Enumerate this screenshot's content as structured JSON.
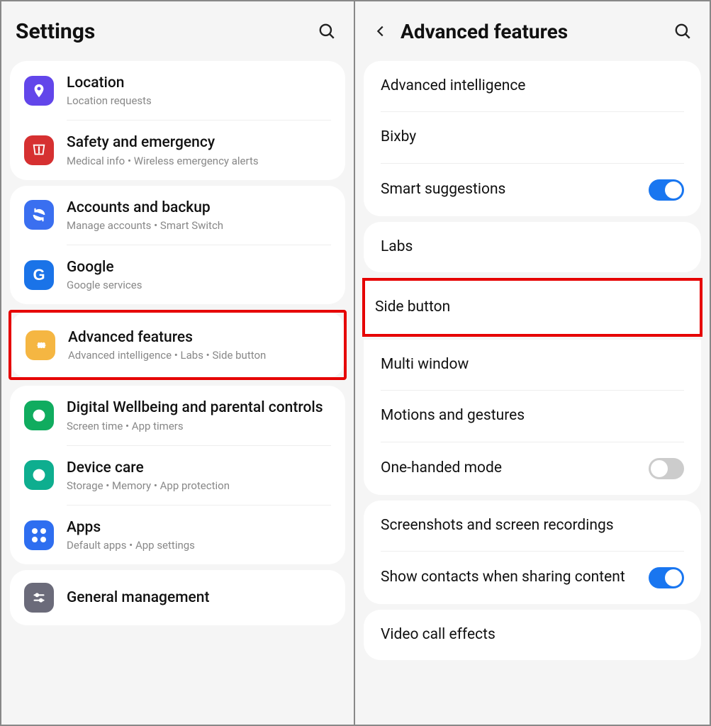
{
  "left": {
    "title": "Settings",
    "groups": [
      {
        "items": [
          {
            "icon": "location",
            "bg": "bg-purple",
            "title": "Location",
            "sub": "Location requests"
          },
          {
            "icon": "safety",
            "bg": "bg-red",
            "title": "Safety and emergency",
            "sub": "Medical info  •  Wireless emergency alerts"
          }
        ]
      },
      {
        "items": [
          {
            "icon": "sync",
            "bg": "bg-blue",
            "title": "Accounts and backup",
            "sub": "Manage accounts  •  Smart Switch"
          },
          {
            "icon": "google",
            "bg": "bg-gblue",
            "title": "Google",
            "sub": "Google services"
          }
        ]
      }
    ],
    "highlighted": {
      "icon": "gear",
      "bg": "bg-yellow",
      "title": "Advanced features",
      "sub": "Advanced intelligence  •  Labs  •  Side button"
    },
    "groups2": [
      {
        "items": [
          {
            "icon": "wellbeing",
            "bg": "bg-green",
            "title": "Digital Wellbeing and parental controls",
            "sub": "Screen time  •  App timers"
          },
          {
            "icon": "device",
            "bg": "bg-teal",
            "title": "Device care",
            "sub": "Storage  •  Memory  •  App protection"
          },
          {
            "icon": "apps",
            "bg": "bg-eblue",
            "title": "Apps",
            "sub": "Default apps  •  App settings"
          }
        ]
      },
      {
        "items": [
          {
            "icon": "general",
            "bg": "bg-grey",
            "title": "General management",
            "sub": ""
          }
        ]
      }
    ]
  },
  "right": {
    "title": "Advanced features",
    "groups": [
      [
        {
          "title": "Advanced intelligence",
          "toggle": null
        },
        {
          "title": "Bixby",
          "toggle": null
        },
        {
          "title": "Smart suggestions",
          "toggle": true
        }
      ],
      [
        {
          "title": "Labs",
          "toggle": null
        }
      ]
    ],
    "highlighted": {
      "title": "Side button"
    },
    "groups2": [
      [
        {
          "title": "Multi window",
          "toggle": null
        },
        {
          "title": "Motions and gestures",
          "toggle": null
        },
        {
          "title": "One-handed mode",
          "toggle": false
        }
      ],
      [
        {
          "title": "Screenshots and screen recordings",
          "toggle": null
        },
        {
          "title": "Show contacts when sharing content",
          "toggle": true
        }
      ],
      [
        {
          "title": "Video call effects",
          "toggle": null
        }
      ]
    ]
  }
}
